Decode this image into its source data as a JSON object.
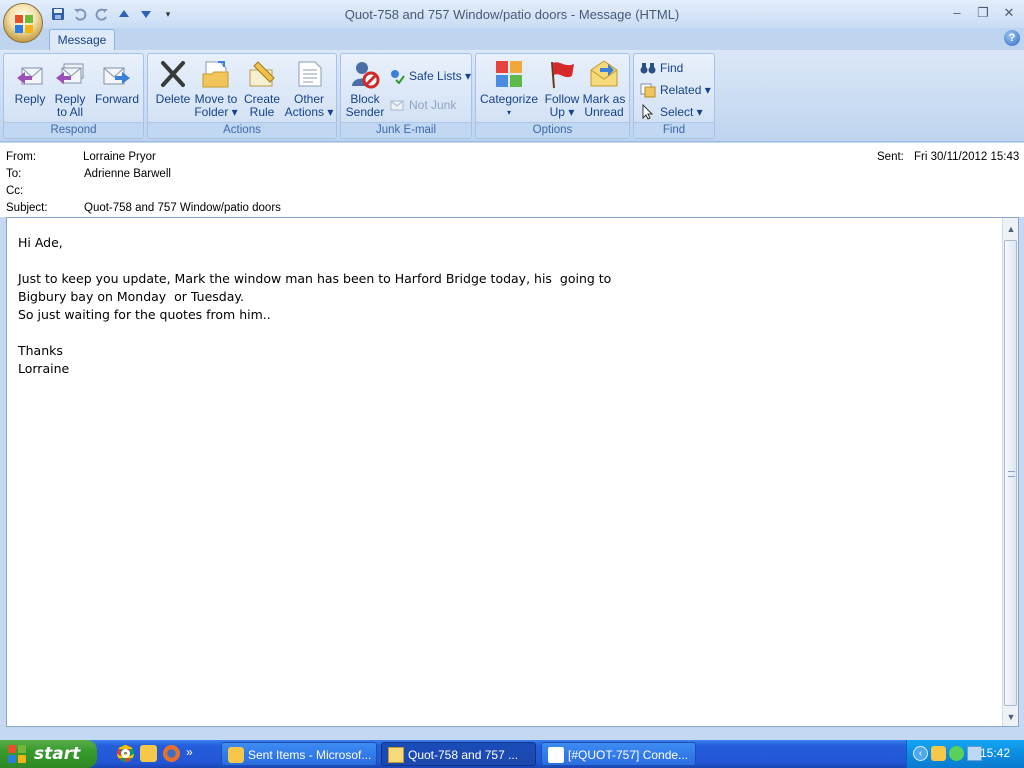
{
  "window": {
    "title": "Quot-758 and 757   Window/patio doors - Message (HTML)",
    "minimize": "–",
    "restore": "❐",
    "close": "✕"
  },
  "ribbon": {
    "tab": "Message",
    "groups": {
      "respond": {
        "label": "Respond",
        "reply": "Reply",
        "reply_all_1": "Reply",
        "reply_all_2": "to All",
        "forward": "Forward"
      },
      "actions": {
        "label": "Actions",
        "delete": "Delete",
        "move_1": "Move to",
        "move_2": "Folder ▾",
        "rule_1": "Create",
        "rule_2": "Rule",
        "other_1": "Other",
        "other_2": "Actions ▾"
      },
      "junk": {
        "label": "Junk E-mail",
        "block_1": "Block",
        "block_2": "Sender",
        "safe_lists": "Safe Lists ▾",
        "not_junk": "Not Junk"
      },
      "options": {
        "label": "Options",
        "categorize_1": "Categorize",
        "categorize_2": "▾",
        "follow_1": "Follow",
        "follow_2": "Up ▾",
        "mark_1": "Mark as",
        "mark_2": "Unread"
      },
      "find": {
        "label": "Find",
        "find": "Find",
        "related": "Related ▾",
        "select": "Select ▾"
      }
    }
  },
  "header": {
    "from_label": "From:",
    "from": "Lorraine Pryor",
    "to_label": "To:",
    "to": "Adrienne Barwell",
    "cc_label": "Cc:",
    "cc": "",
    "subject_label": "Subject:",
    "subject": "Quot-758 and 757   Window/patio doors",
    "sent_label": "Sent:",
    "sent": "Fri 30/11/2012 15:43"
  },
  "body": {
    "lines": [
      "Hi Ade,",
      "",
      "Just to keep you update, Mark the window man has been to Harford Bridge today, his  going to",
      "Bigbury bay on Monday  or Tuesday.",
      "So just waiting for the quotes from him..",
      "",
      "Thanks",
      "Lorraine"
    ]
  },
  "taskbar": {
    "start": "start",
    "tasks": [
      "Sent Items - Microsof...",
      "Quot-758 and 757  ...",
      "[#QUOT-757] Conde..."
    ],
    "more": "»",
    "clock": "15:42"
  }
}
